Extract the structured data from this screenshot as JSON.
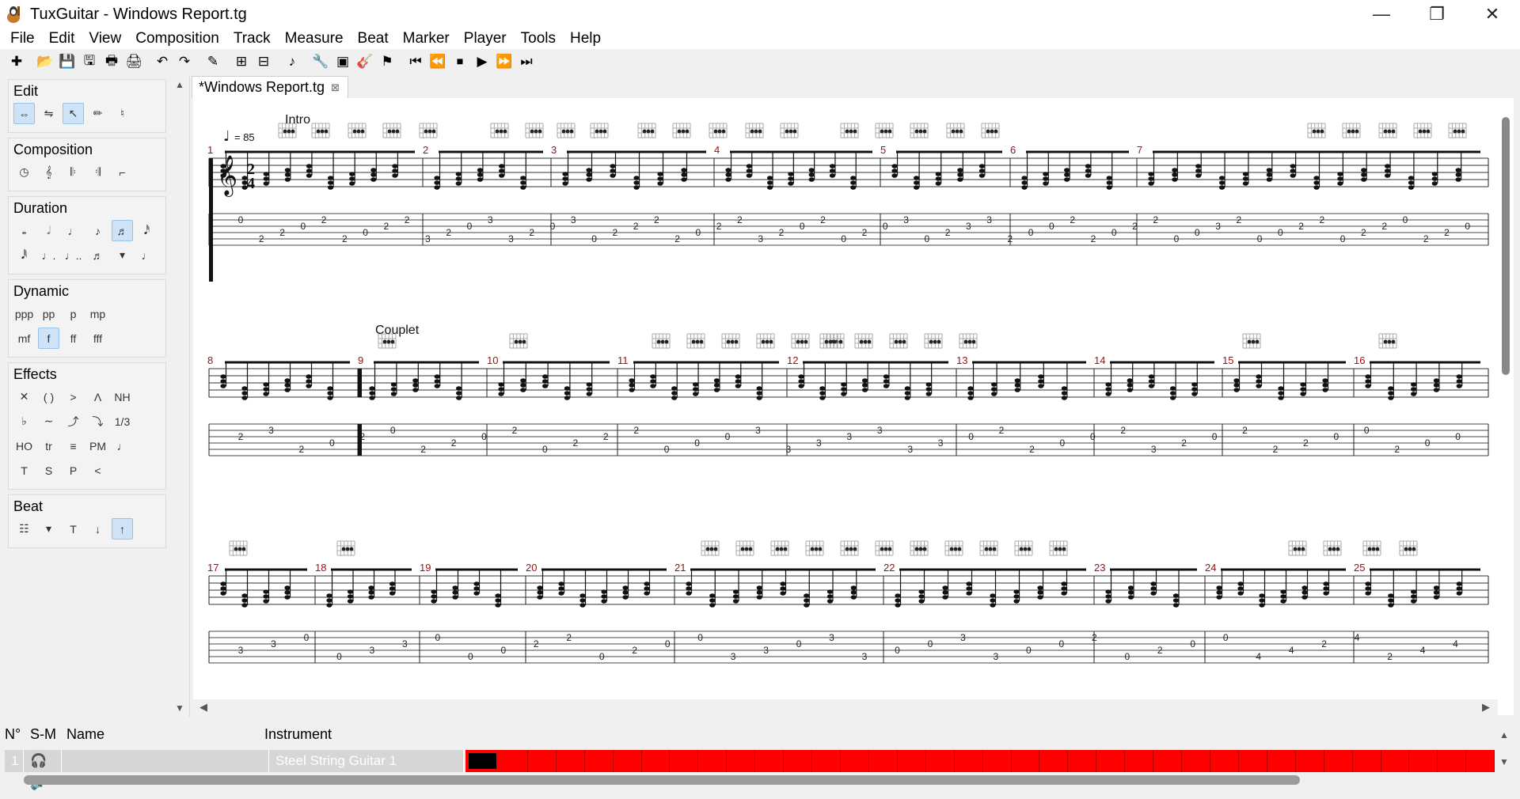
{
  "window": {
    "title": "TuxGuitar - Windows Report.tg",
    "minimize": "—",
    "maximize": "❐",
    "close": "✕"
  },
  "menu": [
    "File",
    "Edit",
    "View",
    "Composition",
    "Track",
    "Measure",
    "Beat",
    "Marker",
    "Player",
    "Tools",
    "Help"
  ],
  "toolbar": {
    "icons": [
      "new-file-icon",
      "open-file-icon",
      "save-icon",
      "save-as-icon",
      "print-icon",
      "print-preview-icon",
      "undo-icon",
      "redo-icon",
      "edit-mode-icon",
      "add-measure-icon",
      "remove-measure-icon",
      "piano-icon",
      "settings-icon",
      "fretboard-icon",
      "tuning-icon",
      "marker-icon",
      "first-icon",
      "previous-icon",
      "stop-icon",
      "play-icon",
      "next-icon",
      "last-icon"
    ],
    "glyphs": [
      "✚",
      "📂",
      "💾",
      "🖫",
      "🖶",
      "🖨",
      "↶",
      "↷",
      "✎",
      "⊞",
      "⊟",
      "♪",
      "🔧",
      "▣",
      "🎸",
      "⚑",
      "⏮",
      "⏪",
      "⏹",
      "▶",
      "⏩",
      "⏭"
    ]
  },
  "panel": {
    "edit": {
      "title": "Edit",
      "glyphs": [
        "⇔",
        "⇋",
        "↖",
        "✏",
        "♮"
      ]
    },
    "composition": {
      "title": "Composition",
      "glyphs": [
        "◷",
        "𝄞",
        "𝄆",
        "𝄇",
        "⌐"
      ]
    },
    "duration": {
      "title": "Duration",
      "row1": [
        "𝅝",
        "𝅗𝅥",
        "♩",
        "♪",
        "♬",
        "𝅘𝅥𝅰"
      ],
      "row2": [
        "𝅘𝅥𝅱",
        "♩.",
        "♩..",
        "♬",
        "▾",
        "♩"
      ]
    },
    "dynamic": {
      "title": "Dynamic",
      "row1": [
        "ppp",
        "pp",
        "p",
        "mp"
      ],
      "row2": [
        "mf",
        "f",
        "ff",
        "fff"
      ]
    },
    "effects": {
      "title": "Effects",
      "row1": [
        "✕",
        "( )",
        ">",
        "Λ",
        "NH"
      ],
      "row2": [
        "♭",
        "∼",
        "⤴",
        "⤵",
        "1/3"
      ],
      "row3": [
        "HO",
        "tr",
        "≡",
        "PM",
        "♩"
      ],
      "row4": [
        "T",
        "S",
        "P",
        "<"
      ]
    },
    "beat": {
      "title": "Beat",
      "glyphs": [
        "☷",
        "▾",
        "T",
        "↓",
        "↑"
      ]
    }
  },
  "document": {
    "tab": "*Windows Report.tg",
    "close": "⊠"
  },
  "score": {
    "tempo": "= 85",
    "time_sig_top": "2",
    "time_sig_bottom": "4",
    "markers": [
      "Intro",
      "Couplet"
    ],
    "systems": [
      {
        "measures": [
          "1",
          "2",
          "3",
          "4",
          "5",
          "6",
          "7"
        ],
        "tab_digits": [
          "0",
          "2",
          "2",
          "0",
          "2",
          "2",
          "0",
          "2",
          "2",
          "3",
          "2",
          "0",
          "3",
          "3",
          "2",
          "0",
          "3",
          "0",
          "2",
          "2",
          "2",
          "2",
          "0",
          "2",
          "2",
          "3",
          "2",
          "0",
          "2",
          "0",
          "2",
          "0",
          "3",
          "0",
          "2",
          "3",
          "3",
          "2",
          "0",
          "0",
          "2",
          "2",
          "0",
          "2",
          "2",
          "0",
          "0",
          "3",
          "2",
          "0",
          "0",
          "2",
          "2",
          "0",
          "2",
          "2",
          "0",
          "2",
          "2",
          "0"
        ]
      },
      {
        "measures": [
          "8",
          "9",
          "10",
          "11",
          "12",
          "13",
          "14",
          "15",
          "16"
        ],
        "tab_digits": [
          "2",
          "3",
          "2",
          "0",
          "2",
          "0",
          "2",
          "2",
          "0",
          "2",
          "0",
          "2",
          "2",
          "2",
          "0",
          "0",
          "0",
          "3",
          "3",
          "3",
          "3",
          "3",
          "3",
          "3",
          "0",
          "2",
          "2",
          "0",
          "0",
          "2",
          "3",
          "2",
          "0",
          "2",
          "2",
          "2",
          "0",
          "0",
          "2",
          "0",
          "0"
        ]
      },
      {
        "measures": [
          "17",
          "18",
          "19",
          "20",
          "21",
          "22",
          "23",
          "24",
          "25"
        ],
        "tab_digits": [
          "3",
          "3",
          "0",
          "0",
          "3",
          "3",
          "0",
          "0",
          "0",
          "2",
          "2",
          "0",
          "2",
          "0",
          "0",
          "3",
          "3",
          "0",
          "3",
          "3",
          "0",
          "0",
          "3",
          "3",
          "0",
          "0",
          "2",
          "0",
          "2",
          "0",
          "0",
          "4",
          "4",
          "2",
          "4",
          "2",
          "4",
          "4"
        ]
      }
    ]
  },
  "tracks": {
    "headers": [
      "N°",
      "S-M",
      "Name",
      "Instrument"
    ],
    "rows": [
      {
        "number": "1",
        "instrument": "Steel String Guitar 1"
      }
    ]
  }
}
